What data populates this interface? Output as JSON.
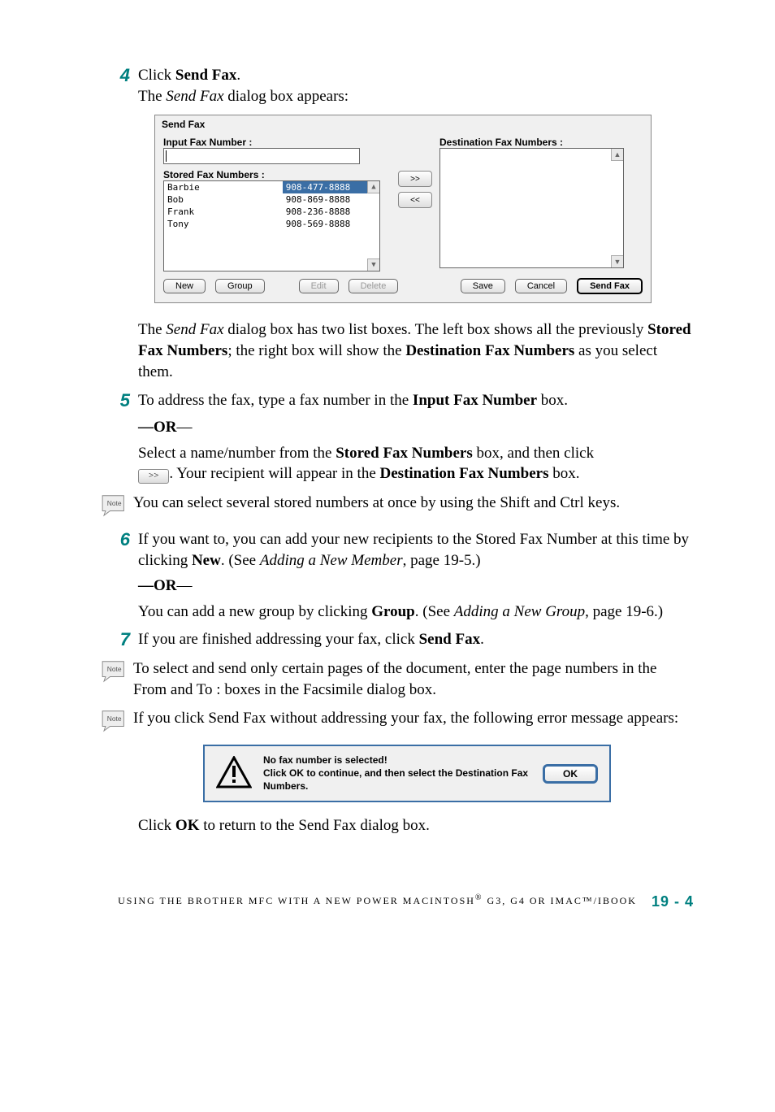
{
  "step4": {
    "num": "4",
    "line1_a": "Click ",
    "line1_b": "Send Fax",
    "line1_c": ".",
    "line2_a": "The ",
    "line2_b": "Send Fax",
    "line2_c": " dialog box appears:"
  },
  "dialog": {
    "title": "Send Fax",
    "input_label": "Input Fax Number :",
    "dest_label": "Destination Fax Numbers :",
    "stored_label": "Stored Fax Numbers :",
    "move_right": ">>",
    "move_left": "<<",
    "stored": [
      {
        "name": "Barbie",
        "num": "908-477-8888",
        "sel": true
      },
      {
        "name": "Bob",
        "num": "908-869-8888"
      },
      {
        "name": "Frank",
        "num": "908-236-8888"
      },
      {
        "name": "Tony",
        "num": "908-569-8888"
      }
    ],
    "buttons": {
      "new": "New",
      "group": "Group",
      "edit": "Edit",
      "delete": "Delete",
      "save": "Save",
      "cancel": "Cancel",
      "sendfax": "Send Fax"
    }
  },
  "para_after_dialog": {
    "a": "The ",
    "b": "Send Fax",
    "c": " dialog box has two list boxes. The left box shows all the previously ",
    "d": "Stored Fax Numbers",
    "e": "; the right box will show the ",
    "f": "Destination Fax Numbers",
    "g": " as you select them."
  },
  "step5": {
    "num": "5",
    "a": "To address the fax, type a fax number in the ",
    "b": "Input Fax Number",
    "c": " box."
  },
  "or": "—OR—",
  "after5": {
    "a": "Select a name/number from the ",
    "b": "Stored Fax Numbers",
    "c": " box, and then click ",
    "btn": ">>",
    "d": ". Your recipient will appear in the ",
    "e": "Destination Fax Numbers",
    "f": " box."
  },
  "note1": "You can select several stored numbers at once by using the Shift and Ctrl keys.",
  "step6": {
    "num": "6",
    "a": "If you want to, you can add your new recipients to the Stored Fax Number at this time by clicking ",
    "b": "New",
    "c": ". (See ",
    "d": "Adding a New Member",
    "e": ", page 19-5.)"
  },
  "after6": {
    "a": "You can add a new group by clicking ",
    "b": "Group",
    "c": ". (See ",
    "d": "Adding a New Group",
    "e": ", page 19-6.)"
  },
  "step7": {
    "num": "7",
    "a": "If you are finished addressing your fax, click ",
    "b": "Send Fax",
    "c": "."
  },
  "note2": "To select and send only certain pages of the document, enter the page numbers in the From and To : boxes in the Facsimile dialog box.",
  "note3": "If you click Send Fax without addressing your fax, the following error message appears:",
  "err": {
    "l1": "No fax number is selected!",
    "l2": "Click OK to continue, and then select the Destination Fax Numbers.",
    "ok": "OK"
  },
  "after_err": {
    "a": "Click ",
    "b": "OK",
    "c": " to return to the Send Fax dialog box."
  },
  "footer": {
    "text": "USING THE BROTHER MFC WITH A NEW POWER MACINTOSH",
    "reg": "®",
    "text2": " G3, G4 OR IMAC™/IBOOK",
    "page": "19 - 4"
  },
  "note_label": "Note"
}
